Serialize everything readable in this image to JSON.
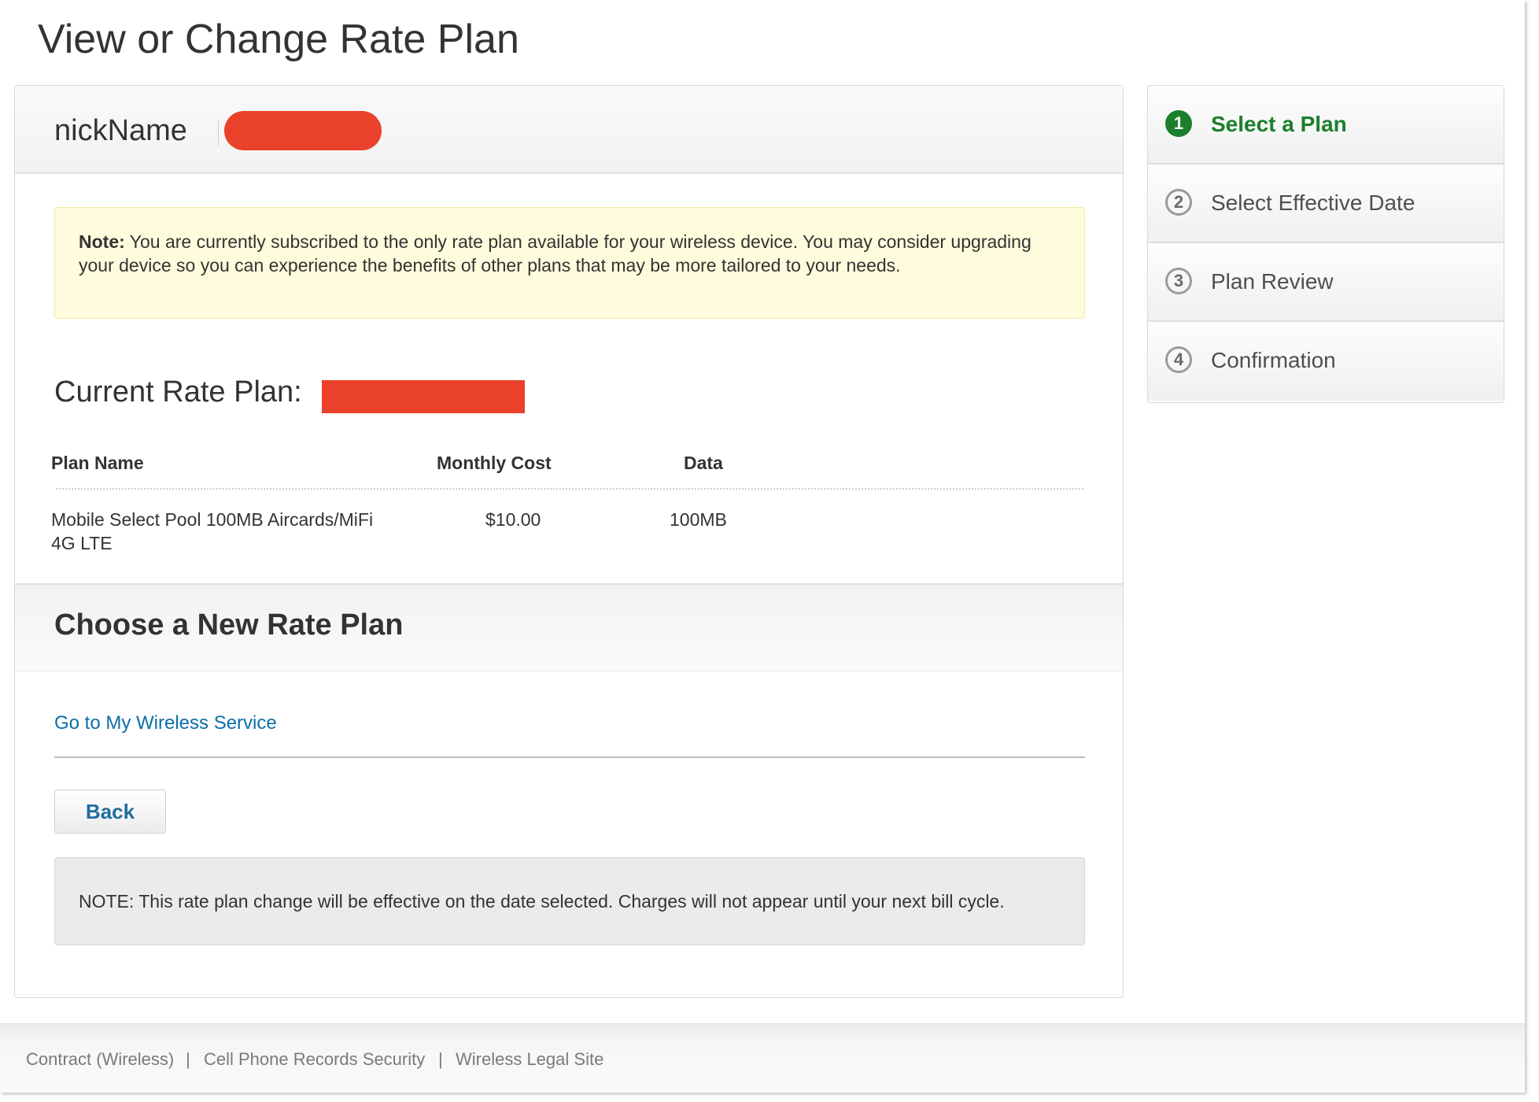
{
  "page": {
    "title": "View or Change Rate Plan"
  },
  "device": {
    "nickname_label": "nickName"
  },
  "note": {
    "label": "Note:",
    "text": "You are currently subscribed to the only rate plan available for your wireless device. You may consider upgrading your device so you can experience the benefits of other plans that may be more tailored to your needs."
  },
  "current_plan": {
    "heading": "Current Rate Plan:",
    "columns": [
      "Plan Name",
      "Monthly Cost",
      "Data"
    ],
    "row": {
      "plan_name_line1": "Mobile Select Pool 100MB Aircards/MiFi",
      "plan_name_line2": "4G LTE",
      "monthly_cost": "$10.00",
      "data": "100MB"
    }
  },
  "choose": {
    "heading": "Choose a New Rate Plan",
    "link": "Go to My Wireless Service",
    "back_label": "Back",
    "bottom_note": "NOTE: This rate plan change will be effective on the date selected. Charges will not appear until your next bill cycle."
  },
  "steps": [
    {
      "number": "1",
      "label": "Select a Plan",
      "active": true
    },
    {
      "number": "2",
      "label": "Select Effective Date",
      "active": false
    },
    {
      "number": "3",
      "label": "Plan Review",
      "active": false
    },
    {
      "number": "4",
      "label": "Confirmation",
      "active": false
    }
  ],
  "footer": {
    "links": [
      "Contract (Wireless)",
      "Cell Phone Records Security",
      "Wireless Legal Site"
    ],
    "separator": "|"
  },
  "colors": {
    "accent_green": "#1b7f2c",
    "link_blue": "#0a6fa6",
    "redaction_red": "#ea412b",
    "note_yellow": "#fefcdc"
  }
}
